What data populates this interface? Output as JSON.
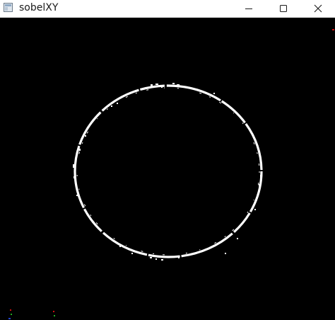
{
  "window": {
    "title": "sobelXY",
    "controls": {
      "minimize_icon": "minimize-icon",
      "maximize_icon": "maximize-icon",
      "close_icon": "close-icon"
    }
  },
  "canvas": {
    "background": "#000000",
    "edge_color": "#ffffff"
  }
}
